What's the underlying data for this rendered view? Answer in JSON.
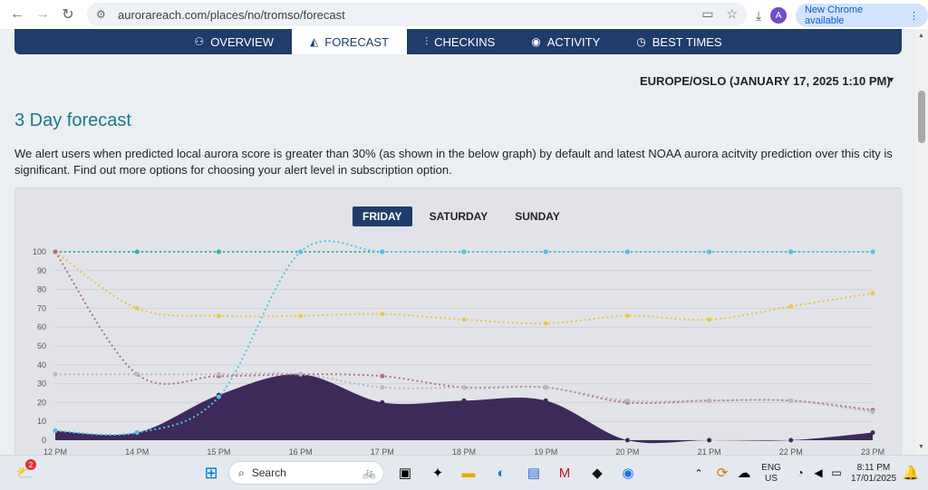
{
  "browser": {
    "url": "aurorareach.com/places/no/tromso/forecast",
    "new_chrome_label": "New Chrome available",
    "avatar_letter": "A"
  },
  "tabs": [
    {
      "label": "OVERVIEW",
      "icon": "binoculars-icon",
      "active": false
    },
    {
      "label": "FORECAST",
      "icon": "chart-area-icon",
      "active": true
    },
    {
      "label": "CHECKINS",
      "icon": "checkin-icon",
      "active": false
    },
    {
      "label": "ACTIVITY",
      "icon": "eye-icon",
      "active": false
    },
    {
      "label": "BEST TIMES",
      "icon": "clock-icon",
      "active": false
    }
  ],
  "timezone_label": "EUROPE/OSLO (JANUARY 17, 2025 1:10 PM)",
  "heading": "3 Day forecast",
  "description": "We alert users when predicted local aurora score is greater than 30% (as shown in the below graph) by default and latest NOAA aurora acitvity prediction over this city is significant. Find out more options for choosing your alert level in subscription option.",
  "day_tabs": [
    {
      "label": "FRIDAY",
      "active": true
    },
    {
      "label": "SATURDAY",
      "active": false
    },
    {
      "label": "SUNDAY",
      "active": false
    }
  ],
  "chart_data": {
    "type": "line",
    "x": [
      "12 PM",
      "14 PM",
      "15 PM",
      "16 PM",
      "17 PM",
      "18 PM",
      "19 PM",
      "20 PM",
      "21 PM",
      "22 PM",
      "23 PM"
    ],
    "ylim": [
      0,
      100
    ],
    "yticks": [
      0,
      10,
      20,
      30,
      40,
      50,
      60,
      70,
      80,
      90,
      100
    ],
    "series": [
      {
        "color": "#3d2a5a",
        "style": "area",
        "values": [
          5,
          4,
          24,
          35,
          20,
          21,
          21,
          0,
          0,
          0,
          4
        ]
      },
      {
        "color": "#2bb5a8",
        "style": "dotted",
        "values": [
          100,
          100,
          100,
          100,
          100,
          100,
          100,
          100,
          100,
          100,
          100
        ]
      },
      {
        "color": "#4fc4e6",
        "style": "dotted",
        "values": [
          5,
          4,
          23,
          100,
          100,
          100,
          100,
          100,
          100,
          100,
          100
        ]
      },
      {
        "color": "#e8c64a",
        "style": "dotted",
        "values": [
          100,
          70,
          66,
          66,
          67,
          64,
          62,
          66,
          64,
          71,
          78
        ]
      },
      {
        "color": "#b07080",
        "style": "dotted",
        "values": [
          100,
          35,
          34,
          35,
          34,
          28,
          28,
          20,
          21,
          21,
          16
        ]
      },
      {
        "color": "#b9b6bf",
        "style": "dotted",
        "values": [
          35,
          35,
          35,
          35,
          28,
          28,
          28,
          21,
          21,
          21,
          15
        ]
      }
    ],
    "grid": true
  },
  "taskbar": {
    "search_placeholder": "Search",
    "weather_badge": "2",
    "lang_line1": "ENG",
    "lang_line2": "US",
    "time": "8:11 PM",
    "date": "17/01/2025"
  }
}
